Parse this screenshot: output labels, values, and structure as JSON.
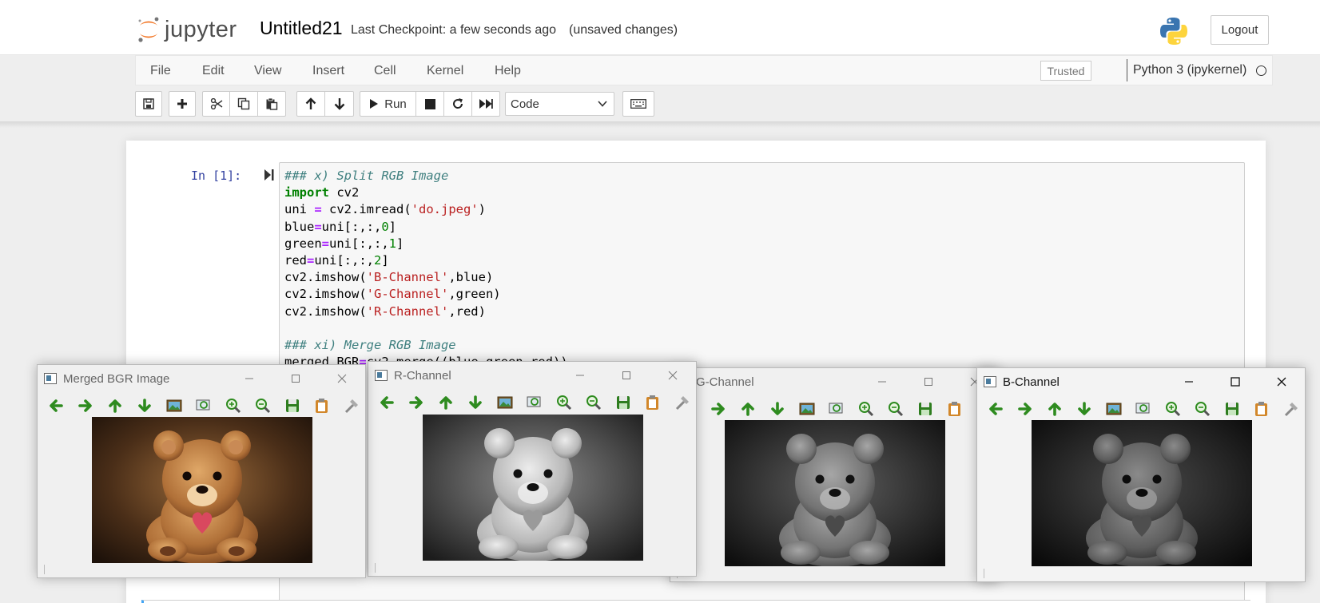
{
  "header": {
    "logo_text": "jupyter",
    "notebook_title": "Untitled21",
    "checkpoint": "Last Checkpoint: a few seconds ago",
    "save_status": "(unsaved changes)",
    "logout_label": "Logout",
    "python_logo_icon": "python-logo-icon"
  },
  "menubar": {
    "items": [
      "File",
      "Edit",
      "View",
      "Insert",
      "Cell",
      "Kernel",
      "Help"
    ],
    "trusted_label": "Trusted",
    "kernel_name": "Python 3 (ipykernel)",
    "kernel_status_icon": "kernel-idle-circle-icon"
  },
  "toolbar": {
    "icons": [
      "save-icon",
      "plus-icon",
      "cut-icon",
      "copy-icon",
      "paste-icon",
      "arrow-up-icon",
      "arrow-down-icon",
      "play-icon",
      "stop-icon",
      "restart-icon",
      "fast-forward-icon",
      "keyboard-icon"
    ],
    "run_label": "Run",
    "cell_type": "Code"
  },
  "cell": {
    "prompt": "In [1]:",
    "code_lines": [
      "### x) Split RGB Image",
      "import cv2",
      "uni = cv2.imread('do.jpeg')",
      "blue=uni[:,:,0]",
      "green=uni[:,:,1]",
      "red=uni[:,:,2]",
      "cv2.imshow('B-Channel',blue)",
      "cv2.imshow('G-Channel',green)",
      "cv2.imshow('R-Channel',red)",
      "",
      "### xi) Merge RGB Image",
      "merged_BGR=cv2.merge((blue,green,red))"
    ]
  },
  "windows": {
    "merged": {
      "title": "Merged BGR Image"
    },
    "r_channel": {
      "title": "R-Channel"
    },
    "g_channel": {
      "title": "G-Channel"
    },
    "b_channel": {
      "title": "B-Channel"
    },
    "toolbar_icons": [
      "arrow-left-icon",
      "arrow-right-icon",
      "arrow-up-icon",
      "arrow-down-icon",
      "image-icon",
      "zoom-fit-icon",
      "zoom-in-icon",
      "zoom-out-icon",
      "save-icon",
      "copy-icon",
      "properties-icon"
    ],
    "image_subject": "teddy bear holding a heart"
  },
  "colors": {
    "jupyter_orange": "#f37726",
    "prompt_blue": "#303f9f",
    "code_comment": "#408080",
    "code_keyword": "#008000",
    "code_string": "#ba2121",
    "code_operator": "#aa22ff"
  }
}
